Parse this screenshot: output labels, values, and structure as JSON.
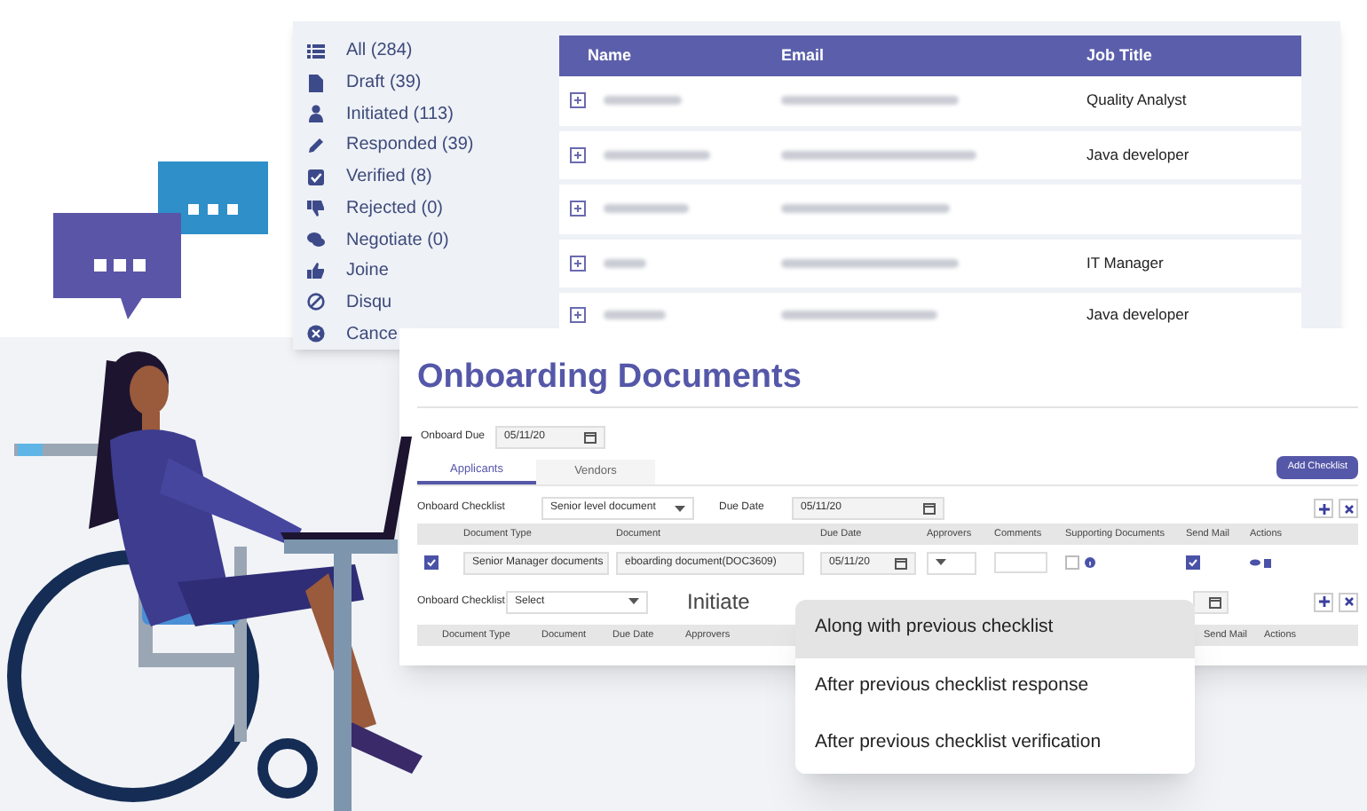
{
  "sidebar": {
    "items": [
      {
        "label": "All (284)"
      },
      {
        "label": "Draft (39)"
      },
      {
        "label": "Initiated (113)"
      },
      {
        "label": "Responded (39)"
      },
      {
        "label": "Verified (8)"
      },
      {
        "label": "Rejected (0)"
      },
      {
        "label": "Negotiate (0)"
      },
      {
        "label": "Joine"
      },
      {
        "label": "Disqu"
      },
      {
        "label": "Cance"
      }
    ]
  },
  "table": {
    "columns": [
      "Name",
      "Email",
      "Job Title"
    ],
    "rows": [
      {
        "job_title": "Quality Analyst"
      },
      {
        "job_title": "Java developer"
      },
      {},
      {
        "job_title": "IT Manager"
      },
      {
        "job_title": "Java developer"
      }
    ]
  },
  "panel": {
    "title": "Onboarding Documents",
    "onboard_due": {
      "label": "Onboard Due",
      "value": "05/11/20"
    },
    "tabs": [
      {
        "label": "Applicants",
        "selected": true
      },
      {
        "label": "Vendors",
        "selected": false
      }
    ],
    "add_button": "Add Checklist",
    "checklist_1": {
      "label": "Onboard Checklist",
      "select": "Senior level document",
      "due_label": "Due Date",
      "due_value": "05/11/20"
    },
    "columns": [
      "Document Type",
      "Document",
      "Due Date",
      "Approvers",
      "Comments",
      "Supporting Documents",
      "Send Mail",
      "Actions"
    ],
    "row": {
      "checked": true,
      "document_type": "Senior Manager documents",
      "document": "eboarding document(DOC3609)",
      "due_date": "05/11/20",
      "supporting_checked": false,
      "send_mail": true
    },
    "checklist_2": {
      "label": "Onboard Checklist",
      "select": "Select",
      "initiate_label": "Initiate"
    },
    "columns_2": [
      "Document Type",
      "Document",
      "Due Date",
      "Approvers",
      "Send Mail",
      "Actions"
    ]
  },
  "initiate_menu": [
    {
      "label": "Along with previous checklist",
      "selected": true
    },
    {
      "label": "After previous checklist response",
      "selected": false
    },
    {
      "label": "After previous checklist verification",
      "selected": false
    }
  ]
}
